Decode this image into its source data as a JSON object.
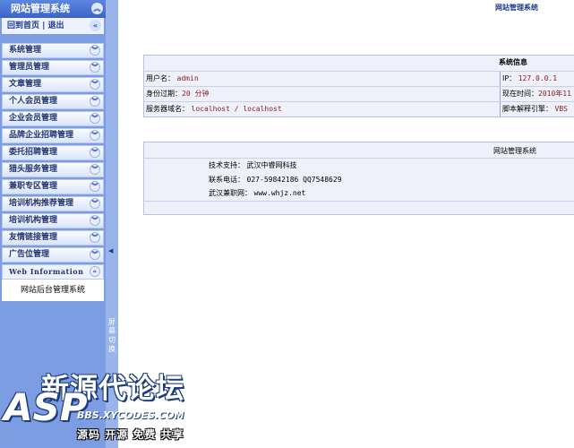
{
  "sidebar": {
    "title": "网站管理系统",
    "links": "回到首页 | 退出",
    "items": [
      {
        "label": "系统管理"
      },
      {
        "label": "管理员管理"
      },
      {
        "label": "文章管理"
      },
      {
        "label": "个人会员管理"
      },
      {
        "label": "企业会员管理"
      },
      {
        "label": "品牌企业招聘管理"
      },
      {
        "label": "委托招聘管理"
      },
      {
        "label": "猎头服务管理"
      },
      {
        "label": "兼职专区管理"
      },
      {
        "label": "培训机构推荐管理"
      },
      {
        "label": "培训机构管理"
      },
      {
        "label": "友情链接管理"
      },
      {
        "label": "广告位管理"
      }
    ],
    "web_info": {
      "title": "Web Information",
      "body": "网站后台管理系统"
    }
  },
  "switch_bar": {
    "label": "屏幕切换"
  },
  "main": {
    "title": "网站管理系统",
    "system_info": {
      "title": "系统信息",
      "rows": [
        {
          "left_label": "用户名：",
          "left_value": "admin",
          "right_label": "IP：",
          "right_value": "127.0.0.1"
        },
        {
          "left_label": "身份过期：",
          "left_value": "20 分钟",
          "right_label": "现在时间：",
          "right_value": "2010年11"
        },
        {
          "left_label": "服务器域名：",
          "left_value": "localhost / localhost",
          "right_label": "脚本解释引擎：",
          "right_value": "VBS"
        }
      ]
    },
    "site_info": {
      "title": "网站管理系统",
      "lines": [
        {
          "label": "技术支持：",
          "value": "武汉中睿网科技"
        },
        {
          "label": "联系电话：",
          "value": "027-59842186 QQ7548629"
        },
        {
          "label": "武汉兼职网：",
          "value": "www.whjz.net"
        }
      ]
    }
  },
  "watermark": {
    "brand": "新源代论坛",
    "logo": "ASP",
    "url": "BBS.XYCODES.COM",
    "slogan": "源码 开源 免费 共享"
  }
}
